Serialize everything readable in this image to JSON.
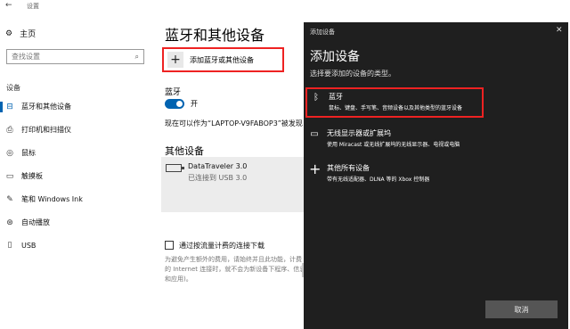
{
  "window": {
    "back_glyph": "←",
    "title": "设置"
  },
  "nav": {
    "home_label": "主页",
    "search_placeholder": "查找设置",
    "section_label": "设备",
    "items": [
      {
        "label": "蓝牙和其他设备",
        "icon": "bluetooth-devices-icon",
        "glyph": "⊟",
        "active": true
      },
      {
        "label": "打印机和扫描仪",
        "icon": "printer-icon",
        "glyph": "⎙",
        "active": false
      },
      {
        "label": "鼠标",
        "icon": "mouse-icon",
        "glyph": "◎",
        "active": false
      },
      {
        "label": "触摸板",
        "icon": "touchpad-icon",
        "glyph": "▭",
        "active": false
      },
      {
        "label": "笔和 Windows Ink",
        "icon": "pen-icon",
        "glyph": "✎",
        "active": false
      },
      {
        "label": "自动播放",
        "icon": "autoplay-icon",
        "glyph": "⊛",
        "active": false
      },
      {
        "label": "USB",
        "icon": "usb-icon",
        "glyph": "▯",
        "active": false
      }
    ]
  },
  "main": {
    "title": "蓝牙和其他设备",
    "add_device_label": "添加蓝牙或其他设备",
    "bluetooth_label": "蓝牙",
    "bluetooth_state": "开",
    "discoverable_text": "现在可以作为“LAPTOP-V9FABOP3”被发现",
    "other_devices_title": "其他设备",
    "device_name": "DataTraveler 3.0",
    "device_status": "已连接到 USB 3.0",
    "metered_label": "通过按流量计费的连接下载",
    "metered_hint": "为避免产生额外的费用，请始终并且此功能，计费的 Internet 连接时，就不会为新设备下程序、信息和应用)。"
  },
  "dialog": {
    "small_title": "添加设备",
    "close_glyph": "✕",
    "title": "添加设备",
    "subtitle": "选择要添加的设备的类型。",
    "options": [
      {
        "title": "蓝牙",
        "desc": "鼠标、键盘、手写笔、音频设备以及其他类型的蓝牙设备",
        "icon": "bluetooth-icon",
        "glyph": "ᛒ"
      },
      {
        "title": "无线显示器或扩展坞",
        "desc": "使用 Miracast 或无线扩展坞的无线显示器、电视或电脑",
        "icon": "monitor-icon",
        "glyph": "▭"
      },
      {
        "title": "其他所有设备",
        "desc": "带有无线适配器、DLNA 等的 Xbox 控制器",
        "icon": "plus-icon",
        "glyph": "+"
      }
    ],
    "cancel_label": "取消"
  },
  "colors": {
    "accent": "#0063b1",
    "highlight": "#ee2222",
    "dialog_bg": "#1f1f1f"
  }
}
